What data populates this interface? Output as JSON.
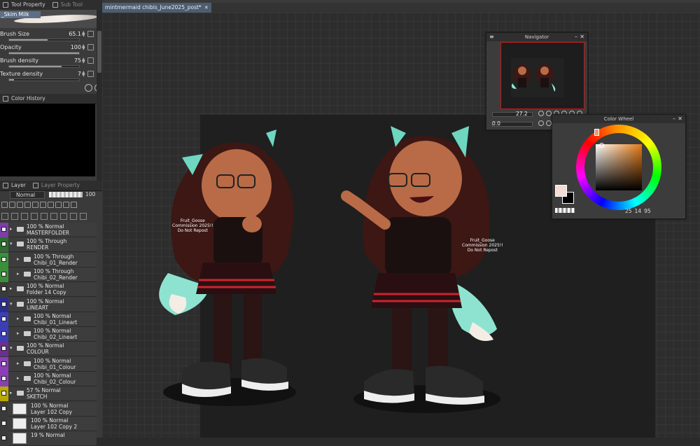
{
  "left_dock": {
    "tabs": [
      {
        "label": "Tool Property"
      },
      {
        "label": "Sub Tool"
      }
    ],
    "brush_name": "_Skim Milk",
    "properties": [
      {
        "label": "Brush Size",
        "value": "65.1",
        "fill": 0.55
      },
      {
        "label": "Opacity",
        "value": "100",
        "fill": 1.0
      },
      {
        "label": "Brush density",
        "value": "75",
        "fill": 0.75
      },
      {
        "label": "Texture density",
        "value": "7",
        "fill": 0.07
      }
    ],
    "color_history_tab": "Color History",
    "layer_tabs": [
      {
        "label": "Layer"
      },
      {
        "label": "Layer Property"
      }
    ],
    "blend_mode": "Normal",
    "layer_opacity": "100",
    "layers": [
      {
        "l1": "100 % Normal",
        "l2": "MASTERFOLDER",
        "color": "#7b3fa6",
        "indent": 0,
        "type": "folder",
        "expanded": false
      },
      {
        "l1": "100 % Through",
        "l2": "RENDER",
        "color": "#2e6e2e",
        "indent": 0,
        "type": "folder",
        "expanded": true
      },
      {
        "l1": "100 % Through",
        "l2": "Chibi_01_Render",
        "color": "#3b8f3b",
        "indent": 1,
        "type": "folder",
        "expanded": false
      },
      {
        "l1": "100 % Through",
        "l2": "Chibi_02_Render",
        "color": "#3b8f3b",
        "indent": 1,
        "type": "folder",
        "expanded": false
      },
      {
        "l1": "100 % Normal",
        "l2": "Folder 14 Copy",
        "color": "#3a3a3a",
        "indent": 0,
        "type": "folder",
        "expanded": false
      },
      {
        "l1": "100 % Normal",
        "l2": "LINEART",
        "color": "#2b2e8f",
        "indent": 0,
        "type": "folder",
        "expanded": true
      },
      {
        "l1": "100 % Normal",
        "l2": "Chibi_01_Lineart",
        "color": "#3b3fb5",
        "indent": 1,
        "type": "folder",
        "expanded": false
      },
      {
        "l1": "100 % Normal",
        "l2": "Chibi_02_Lineart",
        "color": "#3b3fb5",
        "indent": 1,
        "type": "folder",
        "expanded": false
      },
      {
        "l1": "100 % Normal",
        "l2": "COLOUR",
        "color": "#6a2f8f",
        "indent": 0,
        "type": "folder",
        "expanded": true
      },
      {
        "l1": "100 % Normal",
        "l2": "Chibi_01_Colour",
        "color": "#8a3fb8",
        "indent": 1,
        "type": "folder",
        "expanded": false
      },
      {
        "l1": "100 % Normal",
        "l2": "Chibi_02_Colour",
        "color": "#8a3fb8",
        "indent": 1,
        "type": "folder",
        "expanded": false
      },
      {
        "l1": "57 % Normal",
        "l2": "SKETCH",
        "color": "#b9a800",
        "indent": 0,
        "type": "folder",
        "expanded": false
      },
      {
        "l1": "100 % Normal",
        "l2": "Layer 102 Copy",
        "color": "#3a3a3a",
        "indent": 0,
        "type": "layer",
        "expanded": false
      },
      {
        "l1": "100 % Normal",
        "l2": "Layer 102 Copy 2",
        "color": "#3a3a3a",
        "indent": 0,
        "type": "layer",
        "expanded": false
      },
      {
        "l1": "19 % Normal",
        "l2": "",
        "color": "#3a3a3a",
        "indent": 0,
        "type": "layer",
        "expanded": false
      }
    ]
  },
  "document": {
    "tab_title": "mintmermaid chibis_June2025_post*",
    "signature_left": "Fruit_Goose\nCommission 2025!!\nDo Not Repost",
    "signature_right": "Fruit_Goose\nCommission 2025!!\nDo Not Repost"
  },
  "navigator": {
    "title": "Navigator",
    "zoom": "27.2",
    "rotation": "0.0"
  },
  "color_wheel": {
    "title": "Color Wheel",
    "h": "25",
    "s": "14",
    "v": "95",
    "main_color": "#f2dcd4",
    "sub_color": "#000000"
  }
}
